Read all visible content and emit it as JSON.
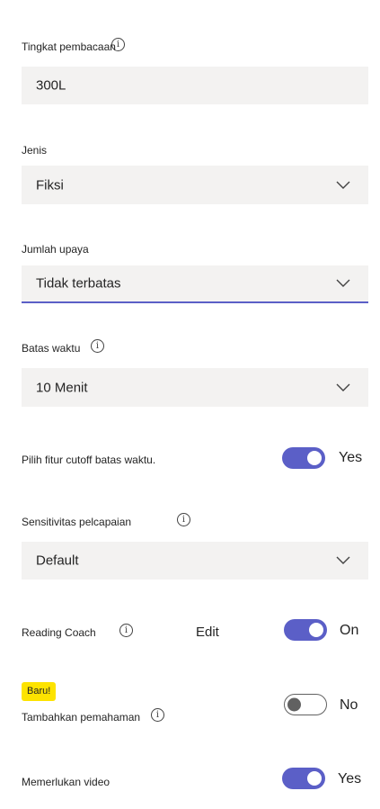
{
  "reading_level": {
    "label": "Tingkat pembacaan",
    "value": "300L"
  },
  "genre": {
    "label": "Jenis",
    "value": "Fiksi"
  },
  "attempts": {
    "label": "Jumlah upaya",
    "value": "Tidak terbatas"
  },
  "time_limit": {
    "label": "Batas waktu",
    "value_number": "10",
    "value_unit": "Menit"
  },
  "cutoff": {
    "label": "Pilih fitur cutoff batas waktu.",
    "state_text": "Yes"
  },
  "sensitivity": {
    "label": "Sensitivitas pelcapaian",
    "value": "Default"
  },
  "reading_coach": {
    "label": "Reading Coach",
    "edit_label": "Edit",
    "state_text": "On"
  },
  "comprehension": {
    "badge": "Baru!",
    "label": "Tambahkan pemahaman",
    "state_text": "No"
  },
  "video": {
    "label": "Memerlukan video",
    "state_text": "Yes"
  },
  "icons": {
    "info": "info-icon",
    "chevron": "chevron-down-icon"
  },
  "colors": {
    "accent": "#5b5fc7",
    "field_bg": "#f3f2f1",
    "badge_bg": "#fde300"
  },
  "info_glyph": "i"
}
